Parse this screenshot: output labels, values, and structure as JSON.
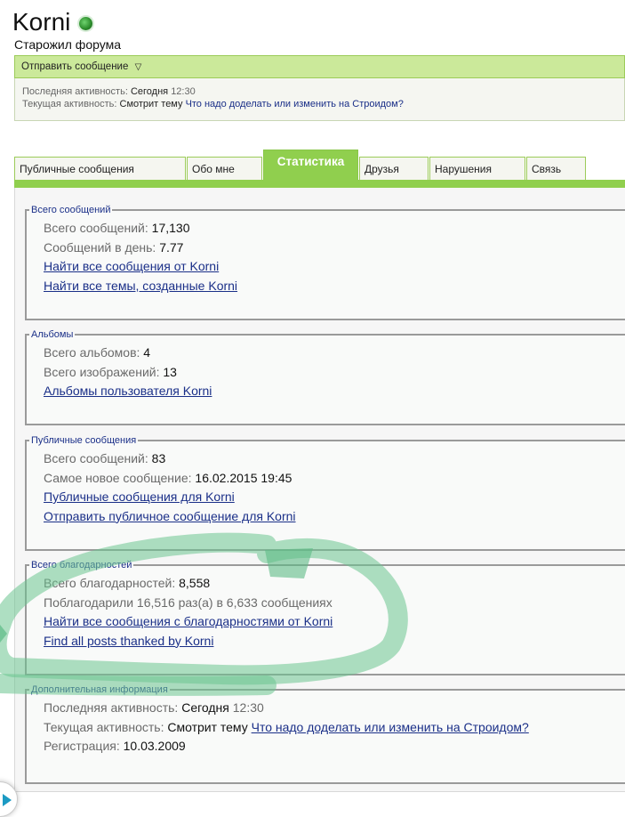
{
  "profile": {
    "name": "Korni",
    "rank": "Старожил форума"
  },
  "message_bar": {
    "label": "Отправить сообщение"
  },
  "activity": {
    "last_label": "Последняя активность:",
    "last_day": "Сегодня",
    "last_time": "12:30",
    "current_label": "Текущая активность:",
    "current_action": "Смотрит тему",
    "current_topic": "Что надо доделать или изменить на Строидом?"
  },
  "tabs": [
    {
      "label": "Публичные сообщения"
    },
    {
      "label": "Обо мне"
    },
    {
      "label": "Статистика"
    },
    {
      "label": "Друзья"
    },
    {
      "label": "Нарушения"
    },
    {
      "label": "Связь"
    }
  ],
  "sections": {
    "posts": {
      "title": "Всего сообщений",
      "total_label": "Всего сообщений:",
      "total_value": "17,130",
      "per_day_label": "Сообщений в день:",
      "per_day_value": "7.77",
      "find_posts_link": "Найти все сообщения от Korni",
      "find_threads_link": "Найти все темы, созданные Korni"
    },
    "albums": {
      "title": "Альбомы",
      "albums_label": "Всего альбомов:",
      "albums_value": "4",
      "images_label": "Всего изображений:",
      "images_value": "13",
      "albums_link": "Альбомы пользователя Korni"
    },
    "public": {
      "title": "Публичные сообщения",
      "total_label": "Всего сообщений:",
      "total_value": "83",
      "newest_label": "Самое новое сообщение:",
      "newest_value": "16.02.2015 19:45",
      "public_link": "Публичные сообщения для Korni",
      "send_link": "Отправить публичное сообщение для Korni"
    },
    "thanks": {
      "title": "Всего благодарностей",
      "total_label": "Всего благодарностей:",
      "total_value": "8,558",
      "thanked_text": "Поблагодарили 16,516 раз(а) в 6,633 сообщениях",
      "find_thanked_link": "Найти все сообщения с благодарностями от Korni",
      "find_thanked_en_link": "Find all posts thanked by Korni"
    },
    "extra": {
      "title": "Дополнительная информация",
      "last_label": "Последняя активность:",
      "last_day": "Сегодня",
      "last_time": "12:30",
      "current_label": "Текущая активность:",
      "current_action": "Смотрит тему",
      "current_topic": "Что надо доделать или изменить на Строидом?",
      "reg_label": "Регистрация:",
      "reg_value": "10.03.2009"
    }
  },
  "colors": {
    "accent_green": "#90cf4e",
    "bar_green": "#cbe99a",
    "link_blue": "#1a2f88",
    "highlight_marker": "#7cc99a"
  },
  "icons": {
    "online": "online-status-icon",
    "dropdown": "triangle-down-icon",
    "scroll": "arrow-right-icon"
  }
}
